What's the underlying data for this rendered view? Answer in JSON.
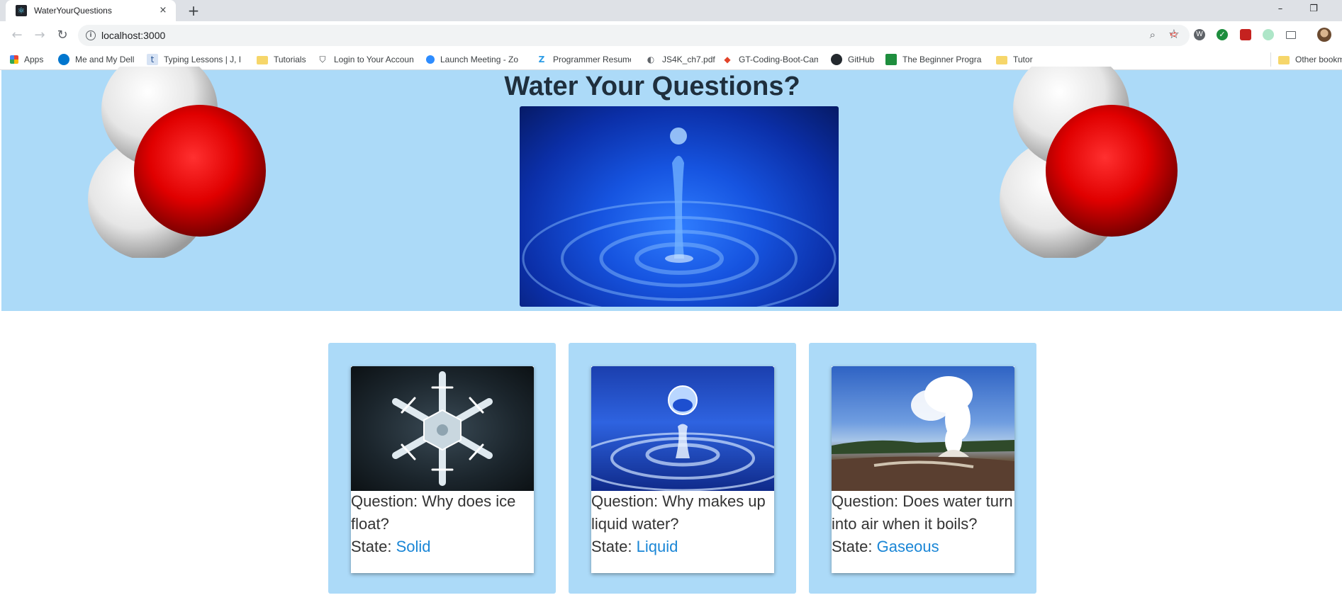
{
  "browser": {
    "tab_title": "WaterYourQuestions",
    "tab_close": "×",
    "new_tab": "+",
    "url": "localhost:3000",
    "window_minimize": "–",
    "window_restore": "❐",
    "nav_back": "←",
    "nav_forward": "→",
    "nav_reload": "↻"
  },
  "bookmarks": [
    {
      "label": "Apps",
      "icon": "apps-grid-icon"
    },
    {
      "label": "Me and My Dell",
      "icon": "dell-icon"
    },
    {
      "label": "Typing Lessons | J, F...",
      "icon": "typing-icon"
    },
    {
      "label": "Tutorials",
      "icon": "folder-icon"
    },
    {
      "label": "Login to Your Accoun",
      "icon": "shield-icon"
    },
    {
      "label": "Launch Meeting - Zo",
      "icon": "zoom-icon"
    },
    {
      "label": "Programmer Resume",
      "icon": "zety-icon"
    },
    {
      "label": "JS4K_ch7.pdf",
      "icon": "pdf-icon"
    },
    {
      "label": "GT-Coding-Boot-Cam",
      "icon": "gitlab-icon"
    },
    {
      "label": "GitHub",
      "icon": "github-icon"
    },
    {
      "label": "The Beginner Progra",
      "icon": "beginner-icon"
    },
    {
      "label": "Tutor",
      "icon": "folder-icon"
    },
    {
      "label": "Other bookmarks",
      "icon": "folder-icon"
    }
  ],
  "hero": {
    "title": "Water Your Questions?"
  },
  "cards": [
    {
      "question": "Question: Why does ice float?",
      "state_label": "State: ",
      "state": "Solid",
      "image": "snowflake"
    },
    {
      "question": "Question: Why makes up liquid water?",
      "state_label": "State: ",
      "state": "Liquid",
      "image": "water-droplet"
    },
    {
      "question": "Question: Does water turn into air when it boils?",
      "state_label": "State: ",
      "state": "Gaseous",
      "image": "geyser"
    }
  ],
  "colors": {
    "hero_bg": "#acdaf8",
    "link": "#1a86d6",
    "title": "#1f2f3d"
  }
}
